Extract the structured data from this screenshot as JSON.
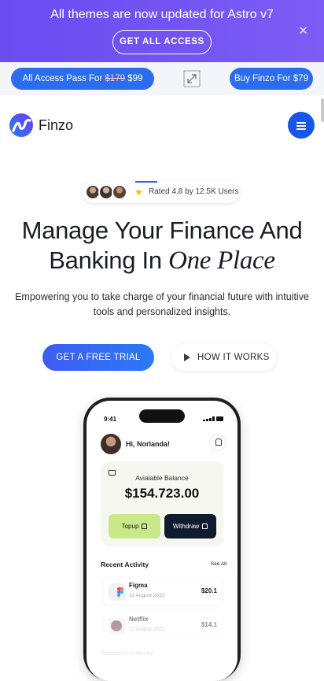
{
  "promo": {
    "title": "All themes are now updated for Astro v7",
    "button": "GET ALL ACCESS",
    "close_icon": "close-icon"
  },
  "passbar": {
    "pass_prefix": "All Access Pass For ",
    "pass_old_price": "$179",
    "pass_new_price": " $99",
    "expand_icon": "expand-icon",
    "buy_label": "Buy Finzo For $79"
  },
  "header": {
    "logo_text": "Finzo",
    "menu_icon": "hamburger-menu-icon"
  },
  "rating": {
    "text": "Rated 4.8 by 12.5K Users",
    "star_icon": "star-icon"
  },
  "hero": {
    "line1": "Manage Your Finance And",
    "line2_plain": "Banking In ",
    "line2_italic": "One Place",
    "subtitle": "Empowering you to take charge of your financial future with intuitive tools and personalized insights."
  },
  "cta": {
    "primary": "GET A FREE TRIAL",
    "secondary": "HOW IT WORKS"
  },
  "phone": {
    "time": "9:41",
    "greeting": "Hi, Norlanda!",
    "balance_label": "Avialable Balance",
    "balance_amount": "$154.723.00",
    "topup": "Topup",
    "withdraw": "Withdraw",
    "recent_activity": "Recent Activity",
    "see_all": "See All",
    "transactions": [
      {
        "name": "Figma",
        "date": "12 August 2022",
        "amount": "$20.1",
        "icon": "figma-icon"
      },
      {
        "name": "Netflix",
        "date": "12 August 2022",
        "amount": "$14.1",
        "icon": "netflix-icon"
      }
    ],
    "faded_text": "Reccemmend Money"
  },
  "colors": {
    "promo_bg": "#6a4cf0",
    "primary_blue": "#2c6df0",
    "menu_blue": "#1656e8",
    "topup_green": "#c8e889",
    "withdraw_navy": "#0f1b2e"
  }
}
